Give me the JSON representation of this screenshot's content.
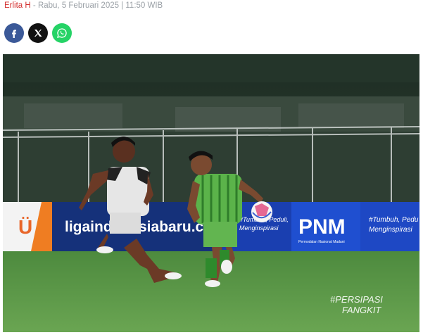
{
  "article": {
    "author": "Erlita H",
    "separator": " - ",
    "date": "Rabu, 5 Februari 2025 | 11:50 WIB"
  },
  "share": {
    "buttons": [
      {
        "icon": "facebook-icon",
        "color": "#3b5998"
      },
      {
        "icon": "x-icon",
        "color": "#111111"
      },
      {
        "icon": "whatsapp-icon",
        "color": "#25d366"
      }
    ]
  },
  "photo": {
    "board_text_1": "ligaindonesiabaru.com",
    "board_text_2": "PNM",
    "board_text_2_sub": "Permodalan Nasional Madani",
    "board_text_3": "#Tumbuh, Pedu",
    "board_text_3b": "Menginspirasi",
    "board_text_mid": "#Tumbuh, Peduli,",
    "board_text_midb": "Menginspirasi",
    "watermark_1": "#PERSIPASI",
    "watermark_2": "FANGKIT"
  }
}
